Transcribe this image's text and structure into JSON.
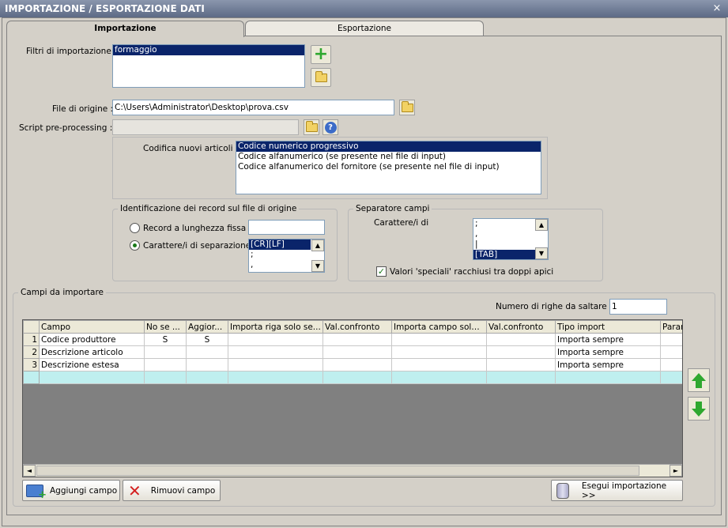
{
  "window": {
    "title": "IMPORTAZIONE / ESPORTAZIONE DATI",
    "close_glyph": "×"
  },
  "tabs": [
    {
      "label": "Importazione",
      "active": true
    },
    {
      "label": "Esportazione",
      "active": false
    }
  ],
  "filters": {
    "label": "Filtri di importazione :",
    "items": [
      "formaggio"
    ],
    "selected_index": 0
  },
  "source_file": {
    "label": "File di origine :",
    "value": "C:\\Users\\Administrator\\Desktop\\prova.csv"
  },
  "script": {
    "label": "Script pre-processing :",
    "value": ""
  },
  "encoding": {
    "label": "Codifica nuovi articoli :",
    "items": [
      "Codice numerico progressivo",
      "Codice alfanumerico (se presente nel file di input)",
      "Codice alfanumerico del fornitore (se presente nel file di input)"
    ],
    "selected_index": 0
  },
  "record_id": {
    "legend": "Identificazione dei record sul file di origine",
    "option_fixed": "Record a lunghezza fissa",
    "option_separator": "Carattere/i di separazione",
    "fixed_value": "",
    "selected": "separator",
    "separators": [
      "[CR][LF]",
      ";",
      ","
    ],
    "selected_separator_index": 0
  },
  "field_sep": {
    "legend": "Separatore campi",
    "label": "Carattere/i di",
    "items": [
      ";",
      ",",
      "|",
      "[TAB]"
    ],
    "selected_index": 3,
    "special_values_label": "Valori 'speciali' racchiusi tra doppi apici",
    "special_values_checked": true
  },
  "fields": {
    "legend": "Campi da importare",
    "skip_rows_label": "Numero di righe da saltare :",
    "skip_rows_value": "1",
    "columns": [
      "Campo",
      "No se ...",
      "Aggior...",
      "Importa riga solo se...",
      "Val.confronto",
      "Importa campo solo s...",
      "Val.confronto",
      "Tipo import",
      "Param"
    ],
    "rows": [
      {
        "num": "1",
        "cells": [
          "Codice produttore",
          "S",
          "S",
          "",
          "",
          "",
          "",
          "Importa sempre",
          ""
        ]
      },
      {
        "num": "2",
        "cells": [
          "Descrizione articolo",
          "",
          "",
          "",
          "",
          "",
          "",
          "Importa sempre",
          ""
        ]
      },
      {
        "num": "3",
        "cells": [
          "Descrizione estesa",
          "",
          "",
          "",
          "",
          "",
          "",
          "Importa sempre",
          ""
        ]
      }
    ]
  },
  "buttons": {
    "add_field": "Aggiungi campo",
    "remove_field": "Rimuovi campo",
    "run_import": "Esegui importazione >>"
  },
  "colors": {
    "selection": "#0a246a",
    "new_row": "#bfefef",
    "grid_bg": "#808080",
    "accent_green": "#2fa82f"
  }
}
